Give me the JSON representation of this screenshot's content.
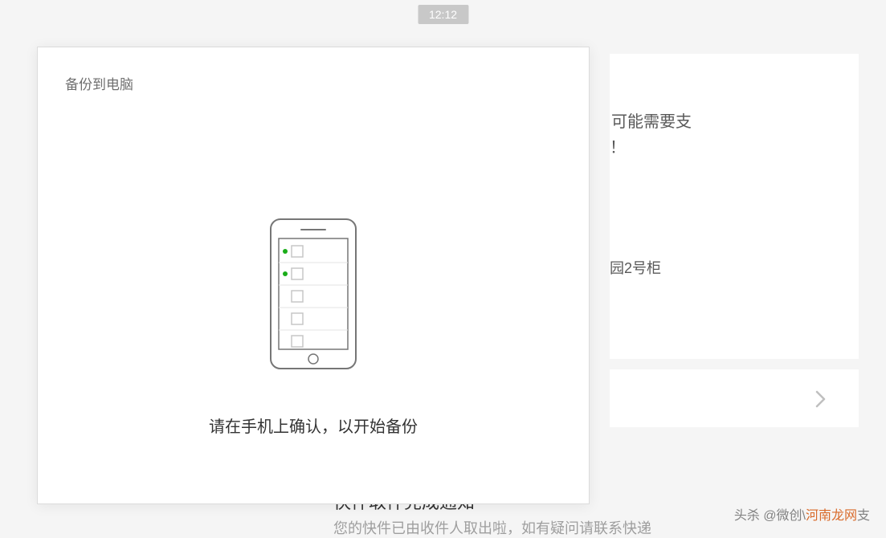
{
  "time": "12:12",
  "dialog": {
    "title": "备份到电脑",
    "instruction": "请在手机上确认，以开始备份"
  },
  "background": {
    "card1_line1": "可能需要支",
    "card1_line2": "！",
    "card1_line3": "园2号柜",
    "card3_title": "快件取件完成通知",
    "card3_sub": "您的快件已由收件人取出啦，如有疑问请联系快递"
  },
  "watermark": {
    "prefix": "头杀 @微创\\",
    "highlight": "河南龙网",
    "suffix": "支"
  }
}
